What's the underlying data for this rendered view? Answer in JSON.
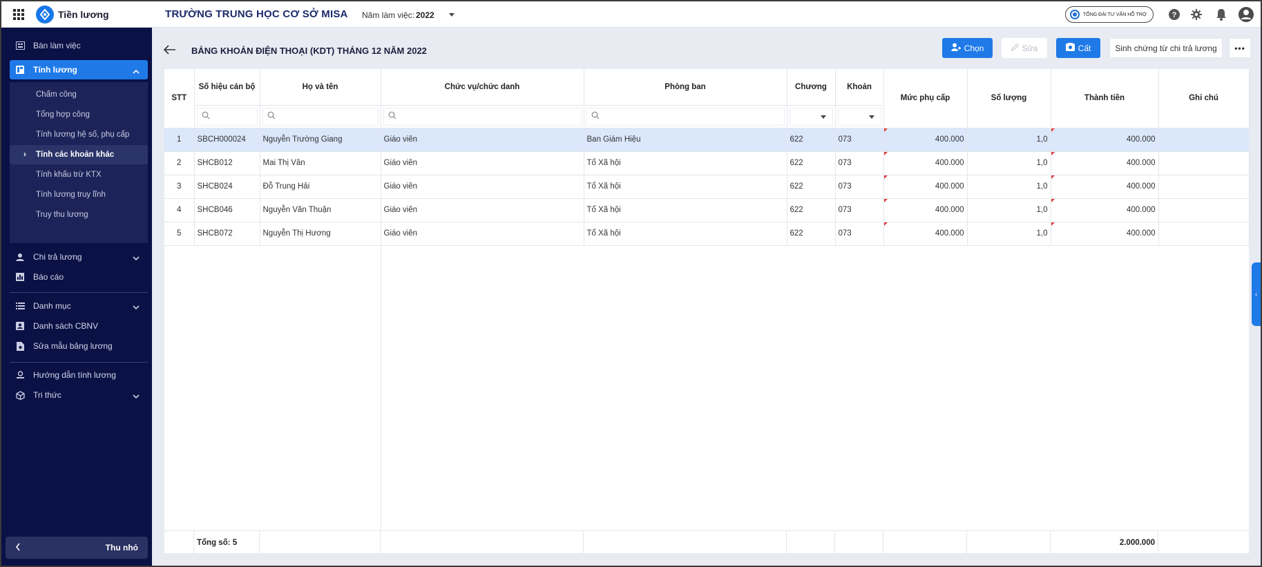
{
  "app": {
    "name": "Tiền lương",
    "school": "TRƯỜNG TRUNG HỌC CƠ SỞ MISA",
    "year_label": "Năm làm việc:",
    "year_value": "2022",
    "support_label": "TỔNG ĐÀI TƯ VẤN HỖ TRỢ"
  },
  "sidebar": {
    "items": [
      {
        "label": "Bàn làm việc",
        "icon": "desk-icon"
      },
      {
        "label": "Tính lương",
        "icon": "calculator-icon"
      },
      {
        "label": "Chi trả lương",
        "icon": "payment-icon"
      },
      {
        "label": "Báo cáo",
        "icon": "report-icon"
      },
      {
        "label": "Danh mục",
        "icon": "list-icon"
      },
      {
        "label": "Danh sách CBNV",
        "icon": "staff-icon"
      },
      {
        "label": "Sửa mẫu bảng lương",
        "icon": "template-icon"
      },
      {
        "label": "Hướng dẫn tính lương",
        "icon": "guide-icon"
      },
      {
        "label": "Tri thức",
        "icon": "knowledge-icon"
      }
    ],
    "sub_items": [
      {
        "label": "Chấm công"
      },
      {
        "label": "Tổng hợp công"
      },
      {
        "label": "Tính lương hệ số, phụ cấp"
      },
      {
        "label": "Tính các khoản khác"
      },
      {
        "label": "Tính khấu trừ KTX"
      },
      {
        "label": "Tính lương truy lĩnh"
      },
      {
        "label": "Truy thu lương"
      }
    ],
    "collapse_label": "Thu nhỏ"
  },
  "page": {
    "title": "BẢNG KHOẢN ĐIỆN THOẠI (KDT) THÁNG 12 NĂM 2022",
    "buttons": {
      "choose": "Chọn",
      "edit": "Sửa",
      "save": "Cất",
      "generate": "Sinh chứng từ chi trả lương"
    }
  },
  "table": {
    "columns": [
      "STT",
      "Số hiệu cán bộ",
      "Họ và tên",
      "Chức vụ/chức danh",
      "Phòng ban",
      "Chương",
      "Khoản",
      "Mức phụ cấp",
      "Số lượng",
      "Thành tiền",
      "Ghi chú"
    ],
    "rows": [
      {
        "stt": "1",
        "id": "SBCH000024",
        "name": "Nguyễn Trường Giang",
        "position": "Giáo viên",
        "dept": "Ban Giám Hiệu",
        "chapter": "622",
        "item": "073",
        "allowance": "400.000",
        "qty": "1,0",
        "amount": "400.000",
        "note": ""
      },
      {
        "stt": "2",
        "id": "SHCB012",
        "name": "Mai Thị Vân",
        "position": "Giáo viên",
        "dept": "Tổ Xã hội",
        "chapter": "622",
        "item": "073",
        "allowance": "400.000",
        "qty": "1,0",
        "amount": "400.000",
        "note": ""
      },
      {
        "stt": "3",
        "id": "SHCB024",
        "name": "Đỗ Trung Hải",
        "position": "Giáo viên",
        "dept": "Tổ Xã hội",
        "chapter": "622",
        "item": "073",
        "allowance": "400.000",
        "qty": "1,0",
        "amount": "400.000",
        "note": ""
      },
      {
        "stt": "4",
        "id": "SHCB046",
        "name": "Nguyễn Văn Thuận",
        "position": "Giáo viên",
        "dept": "Tổ Xã hội",
        "chapter": "622",
        "item": "073",
        "allowance": "400.000",
        "qty": "1,0",
        "amount": "400.000",
        "note": ""
      },
      {
        "stt": "5",
        "id": "SHCB072",
        "name": "Nguyễn Thị Hương",
        "position": "Giáo viên",
        "dept": "Tổ Xã hội",
        "chapter": "622",
        "item": "073",
        "allowance": "400.000",
        "qty": "1,0",
        "amount": "400.000",
        "note": ""
      }
    ],
    "footer": {
      "total_label": "Tổng số: 5",
      "total_amount": "2.000.000"
    }
  },
  "colors": {
    "sidebar_bg": "#0a1145",
    "accent": "#1f7ae8",
    "selected_row": "#dbe7fb"
  }
}
